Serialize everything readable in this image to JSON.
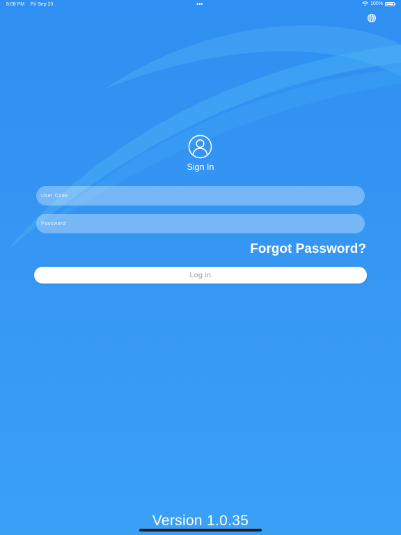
{
  "status_bar": {
    "time": "8:08 PM",
    "date": "Fri Sep 23",
    "multitask_dots": "•••",
    "battery_text": "100%",
    "wifi_icon": "wifi-icon",
    "battery_icon": "battery-icon"
  },
  "header": {
    "language_icon": "globe-icon"
  },
  "login": {
    "avatar_icon": "user-circle-icon",
    "title": "Sign In",
    "user_code": {
      "placeholder": "User Code",
      "value": ""
    },
    "password": {
      "placeholder": "Password",
      "value": ""
    },
    "forgot_label": "Forgot Password?",
    "login_label": "Log in"
  },
  "footer": {
    "version": "Version 1.0.35"
  },
  "colors": {
    "background_top": "#2f8ff2",
    "background_bottom": "#3aa0f6",
    "field_fill": "rgba(255,255,255,0.32)",
    "button_fill": "#ffffff",
    "button_text": "#9b9b9b"
  }
}
